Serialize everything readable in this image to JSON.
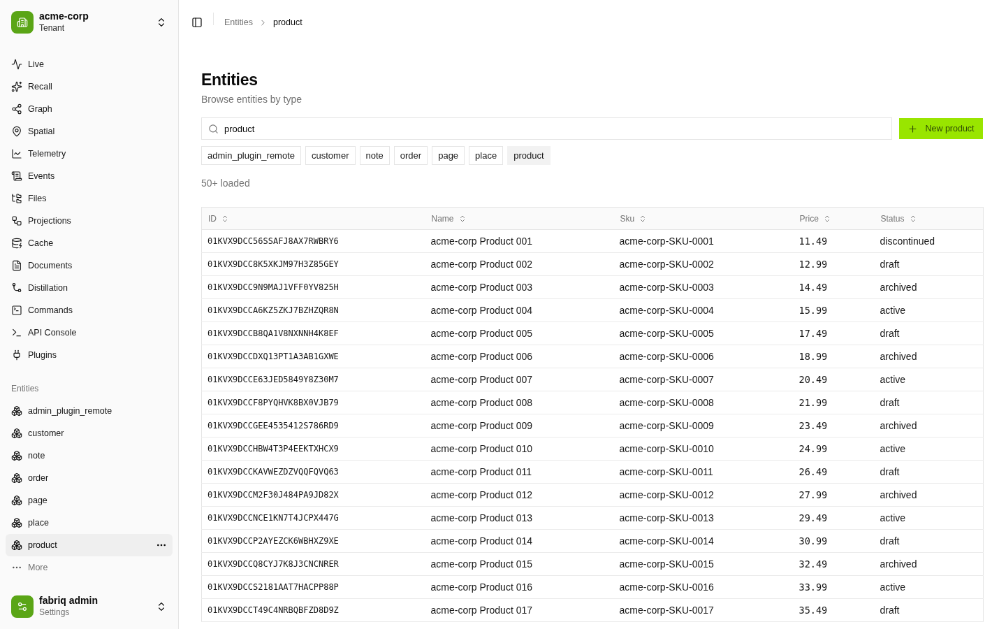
{
  "tenant": {
    "name": "acme-corp",
    "role": "Tenant"
  },
  "nav": {
    "items": [
      {
        "label": "Live",
        "selected": false
      },
      {
        "label": "Recall",
        "selected": false
      },
      {
        "label": "Graph",
        "selected": false
      },
      {
        "label": "Spatial",
        "selected": false
      },
      {
        "label": "Telemetry",
        "selected": false
      },
      {
        "label": "Events",
        "selected": false
      },
      {
        "label": "Files",
        "selected": false
      },
      {
        "label": "Projections",
        "selected": false
      },
      {
        "label": "Cache",
        "selected": false
      },
      {
        "label": "Documents",
        "selected": false
      },
      {
        "label": "Distillation",
        "selected": false
      },
      {
        "label": "Commands",
        "selected": false
      },
      {
        "label": "API Console",
        "selected": false
      },
      {
        "label": "Plugins",
        "selected": false
      }
    ]
  },
  "entities_group": {
    "title": "Entities",
    "items": [
      {
        "label": "admin_plugin_remote",
        "selected": false
      },
      {
        "label": "customer",
        "selected": false
      },
      {
        "label": "note",
        "selected": false
      },
      {
        "label": "order",
        "selected": false
      },
      {
        "label": "page",
        "selected": false
      },
      {
        "label": "place",
        "selected": false
      },
      {
        "label": "product",
        "selected": true
      }
    ],
    "more": "More"
  },
  "user": {
    "name": "fabriq admin",
    "subtitle": "Settings"
  },
  "breadcrumb": [
    "Entities",
    "product"
  ],
  "page": {
    "title": "Entities",
    "subtitle": "Browse entities by type"
  },
  "search": {
    "value": "product"
  },
  "new_button": "New product",
  "type_chips": [
    {
      "label": "admin_plugin_remote",
      "selected": false
    },
    {
      "label": "customer",
      "selected": false
    },
    {
      "label": "note",
      "selected": false
    },
    {
      "label": "order",
      "selected": false
    },
    {
      "label": "page",
      "selected": false
    },
    {
      "label": "place",
      "selected": false
    },
    {
      "label": "product",
      "selected": true
    }
  ],
  "loaded_count": "50+ loaded",
  "table": {
    "columns": [
      "ID",
      "Name",
      "Sku",
      "Price",
      "Status"
    ],
    "rows": [
      [
        "01KVX9DCC56SSAFJ8AX7RWBRY6",
        "acme-corp Product 001",
        "acme-corp-SKU-0001",
        "11.49",
        "discontinued"
      ],
      [
        "01KVX9DCC8K5XKJM97H3Z85GEY",
        "acme-corp Product 002",
        "acme-corp-SKU-0002",
        "12.99",
        "draft"
      ],
      [
        "01KVX9DCC9N9MAJ1VFF0YV825H",
        "acme-corp Product 003",
        "acme-corp-SKU-0003",
        "14.49",
        "archived"
      ],
      [
        "01KVX9DCCA6KZ5ZKJ7BZHZQR8N",
        "acme-corp Product 004",
        "acme-corp-SKU-0004",
        "15.99",
        "active"
      ],
      [
        "01KVX9DCCB8QA1V8NXNNH4K8EF",
        "acme-corp Product 005",
        "acme-corp-SKU-0005",
        "17.49",
        "draft"
      ],
      [
        "01KVX9DCCDXQ13PT1A3AB1GXWE",
        "acme-corp Product 006",
        "acme-corp-SKU-0006",
        "18.99",
        "archived"
      ],
      [
        "01KVX9DCCE63JED5849Y8Z30M7",
        "acme-corp Product 007",
        "acme-corp-SKU-0007",
        "20.49",
        "active"
      ],
      [
        "01KVX9DCCF8PYQHVK8BX0VJB79",
        "acme-corp Product 008",
        "acme-corp-SKU-0008",
        "21.99",
        "draft"
      ],
      [
        "01KVX9DCCGEE4535412S786RD9",
        "acme-corp Product 009",
        "acme-corp-SKU-0009",
        "23.49",
        "archived"
      ],
      [
        "01KVX9DCCHBW4T3P4EEKTXHCX9",
        "acme-corp Product 010",
        "acme-corp-SKU-0010",
        "24.99",
        "active"
      ],
      [
        "01KVX9DCCKAVWEZDZVQQFQVQ63",
        "acme-corp Product 011",
        "acme-corp-SKU-0011",
        "26.49",
        "draft"
      ],
      [
        "01KVX9DCCM2F30J484PA9JD82X",
        "acme-corp Product 012",
        "acme-corp-SKU-0012",
        "27.99",
        "archived"
      ],
      [
        "01KVX9DCCNCE1KN7T4JCPX447G",
        "acme-corp Product 013",
        "acme-corp-SKU-0013",
        "29.49",
        "active"
      ],
      [
        "01KVX9DCCP2AYEZCK6WBHXZ9XE",
        "acme-corp Product 014",
        "acme-corp-SKU-0014",
        "30.99",
        "draft"
      ],
      [
        "01KVX9DCCQ8CYJ7K8J3CNCNRER",
        "acme-corp Product 015",
        "acme-corp-SKU-0015",
        "32.49",
        "archived"
      ],
      [
        "01KVX9DCCS2181AAT7HACPP88P",
        "acme-corp Product 016",
        "acme-corp-SKU-0016",
        "33.99",
        "active"
      ],
      [
        "01KVX9DCCT49C4NRBQBFZD8D9Z",
        "acme-corp Product 017",
        "acme-corp-SKU-0017",
        "35.49",
        "draft"
      ]
    ]
  }
}
